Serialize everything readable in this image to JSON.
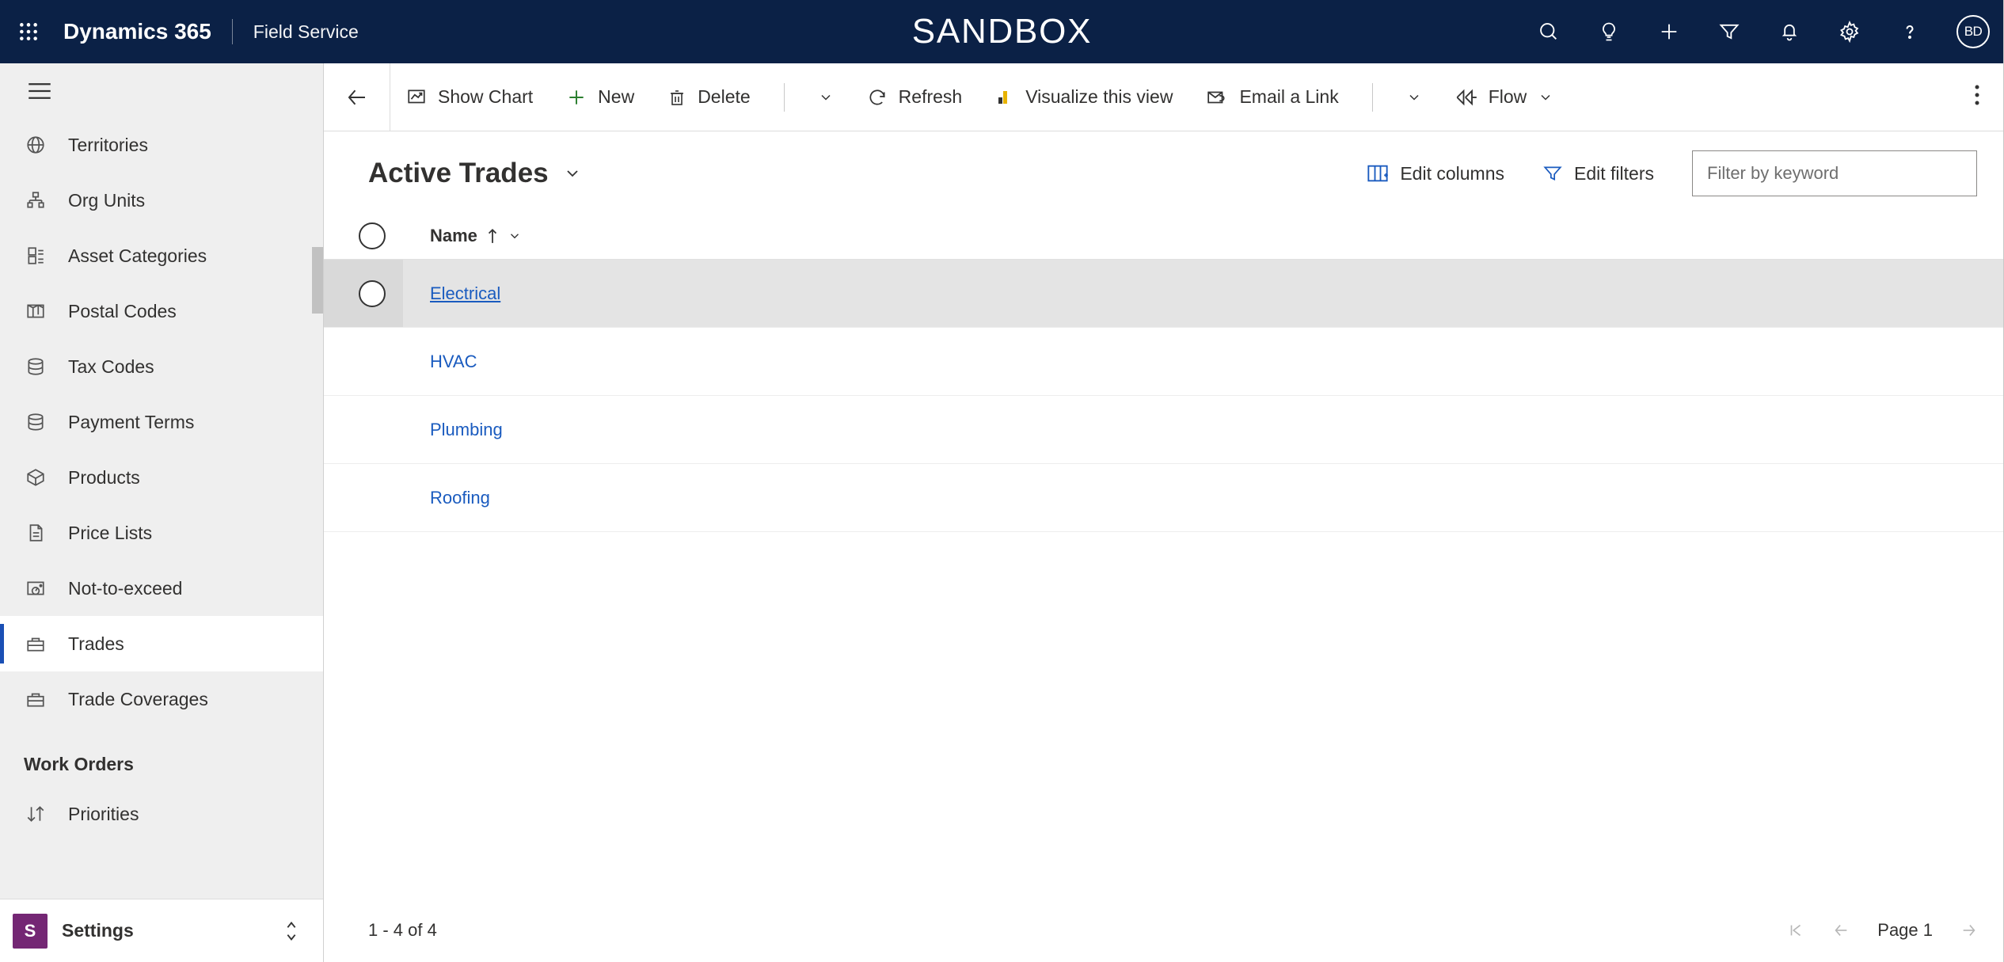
{
  "header": {
    "app": "Dynamics 365",
    "module": "Field Service",
    "environment": "SANDBOX",
    "avatar_initials": "BD"
  },
  "sidebar": {
    "items": [
      {
        "label": "Territories",
        "icon": "globe"
      },
      {
        "label": "Org Units",
        "icon": "org"
      },
      {
        "label": "Asset Categories",
        "icon": "assetcat"
      },
      {
        "label": "Postal Codes",
        "icon": "map"
      },
      {
        "label": "Tax Codes",
        "icon": "stack"
      },
      {
        "label": "Payment Terms",
        "icon": "stack"
      },
      {
        "label": "Products",
        "icon": "box"
      },
      {
        "label": "Price Lists",
        "icon": "doc"
      },
      {
        "label": "Not-to-exceed",
        "icon": "gauge"
      },
      {
        "label": "Trades",
        "icon": "toolbox",
        "selected": true
      },
      {
        "label": "Trade Coverages",
        "icon": "toolbox"
      }
    ],
    "section2": "Work Orders",
    "items2": [
      {
        "label": "Priorities",
        "icon": "sort"
      }
    ],
    "area": {
      "badge": "S",
      "label": "Settings"
    }
  },
  "commands": {
    "show_chart": "Show Chart",
    "new": "New",
    "delete": "Delete",
    "refresh": "Refresh",
    "visualize": "Visualize this view",
    "email": "Email a Link",
    "flow": "Flow"
  },
  "view": {
    "title": "Active Trades",
    "edit_columns": "Edit columns",
    "edit_filters": "Edit filters",
    "filter_placeholder": "Filter by keyword"
  },
  "grid": {
    "column": "Name",
    "rows": [
      {
        "name": "Electrical",
        "hover": true
      },
      {
        "name": "HVAC"
      },
      {
        "name": "Plumbing"
      },
      {
        "name": "Roofing"
      }
    ],
    "count_label": "1 - 4 of 4",
    "page_label": "Page 1"
  }
}
